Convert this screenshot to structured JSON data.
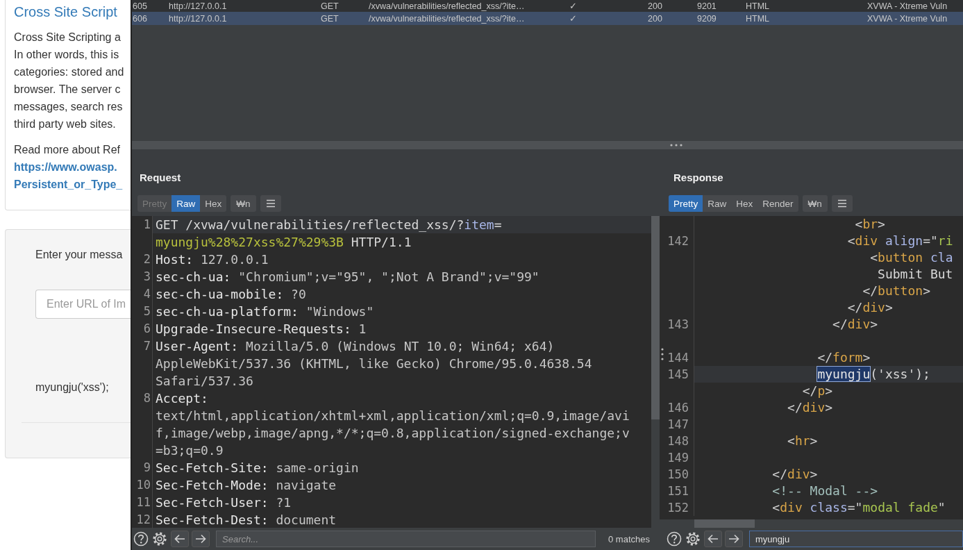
{
  "web_page": {
    "title": "Cross Site Script",
    "paragraph_lines": [
      "Cross Site Scripting a",
      "In other words, this is",
      "categories: stored and",
      "browser. The server c",
      "messages, search res",
      "third party web sites."
    ],
    "read_more": "Read more about Ref",
    "links": [
      "https://www.owasp.",
      "Persistent_or_Type_"
    ],
    "form": {
      "label": "Enter your messa",
      "input_placeholder": "Enter URL of Im",
      "output": "myungju('xss');"
    }
  },
  "history_table": {
    "rows": [
      {
        "selected": false,
        "cells": [
          "605",
          "http://127.0.0.1",
          "GET",
          "/xvwa/vulnerabilities/reflected_xss/?ite…",
          "✓",
          "200",
          "9201",
          "HTML",
          "XVWA - Xtreme Vuln"
        ]
      },
      {
        "selected": true,
        "cells": [
          "606",
          "http://127.0.0.1",
          "GET",
          "/xvwa/vulnerabilities/reflected_xss/?ite…",
          "✓",
          "200",
          "9209",
          "HTML",
          "XVWA - Xtreme Vuln"
        ]
      }
    ]
  },
  "panels": [
    {
      "title": "Request",
      "tabs": [
        {
          "label": "Pretty",
          "selected": false,
          "disabled": true
        },
        {
          "label": "Raw",
          "selected": true,
          "disabled": false
        },
        {
          "label": "Hex",
          "selected": false,
          "disabled": false
        }
      ],
      "newline_toggle": "₩n",
      "rows": [
        {
          "number": "1",
          "current": true,
          "tokens": [
            {
              "kind": "plain",
              "text": "GET /xvwa/vulnerabilities/reflected_xss/?"
            },
            {
              "kind": "param",
              "text": "item"
            },
            {
              "kind": "plain",
              "text": "="
            }
          ]
        },
        {
          "current": false,
          "tokens": [
            {
              "kind": "pvalue",
              "text": "myungju%28%27xss%27%29%3B"
            },
            {
              "kind": "plain",
              "text": " HTTP/1.1"
            }
          ]
        },
        {
          "number": "2",
          "current": false,
          "tokens": [
            {
              "kind": "name",
              "text": "Host:"
            },
            {
              "kind": "value",
              "text": " 127.0.0.1"
            }
          ]
        },
        {
          "number": "3",
          "current": false,
          "tokens": [
            {
              "kind": "name",
              "text": "sec-ch-ua:"
            },
            {
              "kind": "value",
              "text": " \"Chromium\";v=\"95\", \";Not A Brand\";v=\"99\""
            }
          ]
        },
        {
          "number": "4",
          "current": false,
          "tokens": [
            {
              "kind": "name",
              "text": "sec-ch-ua-mobile:"
            },
            {
              "kind": "value",
              "text": " ?0"
            }
          ]
        },
        {
          "number": "5",
          "current": false,
          "tokens": [
            {
              "kind": "name",
              "text": "sec-ch-ua-platform:"
            },
            {
              "kind": "value",
              "text": " \"Windows\""
            }
          ]
        },
        {
          "number": "6",
          "current": false,
          "tokens": [
            {
              "kind": "name",
              "text": "Upgrade-Insecure-Requests:"
            },
            {
              "kind": "value",
              "text": " 1"
            }
          ]
        },
        {
          "number": "7",
          "current": false,
          "tokens": [
            {
              "kind": "name",
              "text": "User-Agent:"
            },
            {
              "kind": "value",
              "text": " Mozilla/5.0 (Windows NT 10.0; Win64; x64)"
            }
          ]
        },
        {
          "current": false,
          "tokens": [
            {
              "kind": "value",
              "text": "AppleWebKit/537.36 (KHTML, like Gecko) Chrome/95.0.4638.54"
            }
          ]
        },
        {
          "current": false,
          "tokens": [
            {
              "kind": "value",
              "text": "Safari/537.36"
            }
          ]
        },
        {
          "number": "8",
          "current": false,
          "tokens": [
            {
              "kind": "name",
              "text": "Accept:"
            }
          ]
        },
        {
          "current": false,
          "tokens": [
            {
              "kind": "value",
              "text": "text/html,application/xhtml+xml,application/xml;q=0.9,image/avi"
            }
          ]
        },
        {
          "current": false,
          "tokens": [
            {
              "kind": "value",
              "text": "f,image/webp,image/apng,*/*;q=0.8,application/signed-exchange;v"
            }
          ]
        },
        {
          "current": false,
          "tokens": [
            {
              "kind": "value",
              "text": "=b3;q=0.9"
            }
          ]
        },
        {
          "number": "9",
          "current": false,
          "tokens": [
            {
              "kind": "name",
              "text": "Sec-Fetch-Site:"
            },
            {
              "kind": "value",
              "text": " same-origin"
            }
          ]
        },
        {
          "number": "10",
          "current": false,
          "tokens": [
            {
              "kind": "name",
              "text": "Sec-Fetch-Mode:"
            },
            {
              "kind": "value",
              "text": " navigate"
            }
          ]
        },
        {
          "number": "11",
          "current": false,
          "tokens": [
            {
              "kind": "name",
              "text": "Sec-Fetch-User:"
            },
            {
              "kind": "value",
              "text": " ?1"
            }
          ]
        },
        {
          "number": "12",
          "current": false,
          "tokens": [
            {
              "kind": "name",
              "text": "Sec-Fetch-Dest:"
            },
            {
              "kind": "value",
              "text": " document"
            }
          ]
        }
      ],
      "search": {
        "placeholder": "Search..."
      },
      "matches": "0 matches"
    },
    {
      "title": "Response",
      "tabs": [
        {
          "label": "Pretty",
          "selected": true,
          "disabled": false
        },
        {
          "label": "Raw",
          "selected": false,
          "disabled": false
        },
        {
          "label": "Hex",
          "selected": false,
          "disabled": false
        },
        {
          "label": "Render",
          "selected": false,
          "disabled": false
        }
      ],
      "newline_toggle": "₩n",
      "rows": [
        {
          "current": false,
          "tokens": [
            {
              "kind": "punct",
              "text": "                     <"
            },
            {
              "kind": "tag",
              "text": "br"
            },
            {
              "kind": "punct",
              "text": ">"
            }
          ]
        },
        {
          "number": "142",
          "current": false,
          "tokens": [
            {
              "kind": "punct",
              "text": "                    <"
            },
            {
              "kind": "tag",
              "text": "div"
            },
            {
              "kind": "attr",
              "text": " align"
            },
            {
              "kind": "punct",
              "text": "=\""
            },
            {
              "kind": "str",
              "text": "ri"
            }
          ]
        },
        {
          "current": false,
          "tokens": [
            {
              "kind": "punct",
              "text": "                       <"
            },
            {
              "kind": "tag",
              "text": "button"
            },
            {
              "kind": "attr",
              "text": " cla"
            }
          ]
        },
        {
          "current": false,
          "tokens": [
            {
              "kind": "text",
              "text": "                        Submit But"
            }
          ]
        },
        {
          "current": false,
          "tokens": [
            {
              "kind": "punct",
              "text": "                      </"
            },
            {
              "kind": "tag",
              "text": "button"
            },
            {
              "kind": "punct",
              "text": ">"
            }
          ]
        },
        {
          "current": false,
          "tokens": [
            {
              "kind": "punct",
              "text": "                    </"
            },
            {
              "kind": "tag",
              "text": "div"
            },
            {
              "kind": "punct",
              "text": ">"
            }
          ]
        },
        {
          "number": "143",
          "current": false,
          "tokens": [
            {
              "kind": "punct",
              "text": "                  </"
            },
            {
              "kind": "tag",
              "text": "div"
            },
            {
              "kind": "punct",
              "text": ">"
            }
          ]
        },
        {
          "current": false
        },
        {
          "number": "144",
          "current": false,
          "tokens": [
            {
              "kind": "punct",
              "text": "                </"
            },
            {
              "kind": "tag",
              "text": "form"
            },
            {
              "kind": "punct",
              "text": ">"
            }
          ]
        },
        {
          "number": "145",
          "current": true,
          "tokens": [
            {
              "kind": "match",
              "text": "                myungju"
            },
            {
              "kind": "text",
              "text": "('xss');"
            }
          ]
        },
        {
          "current": false,
          "tokens": [
            {
              "kind": "punct",
              "text": "              </"
            },
            {
              "kind": "tag",
              "text": "p"
            },
            {
              "kind": "punct",
              "text": ">"
            }
          ]
        },
        {
          "number": "146",
          "current": false,
          "tokens": [
            {
              "kind": "punct",
              "text": "            </"
            },
            {
              "kind": "tag",
              "text": "div"
            },
            {
              "kind": "punct",
              "text": ">"
            }
          ]
        },
        {
          "number": "147",
          "current": false
        },
        {
          "number": "148",
          "current": false,
          "tokens": [
            {
              "kind": "punct",
              "text": "            <"
            },
            {
              "kind": "tag",
              "text": "hr"
            },
            {
              "kind": "punct",
              "text": ">"
            }
          ]
        },
        {
          "number": "149",
          "current": false
        },
        {
          "number": "150",
          "current": false,
          "tokens": [
            {
              "kind": "punct",
              "text": "          </"
            },
            {
              "kind": "tag",
              "text": "div"
            },
            {
              "kind": "punct",
              "text": ">"
            }
          ]
        },
        {
          "number": "151",
          "current": false,
          "tokens": [
            {
              "kind": "comment",
              "text": "          <!-- Modal -->"
            }
          ]
        },
        {
          "number": "152",
          "current": false,
          "tokens": [
            {
              "kind": "punct",
              "text": "          <"
            },
            {
              "kind": "tag",
              "text": "div"
            },
            {
              "kind": "attr",
              "text": " class"
            },
            {
              "kind": "punct",
              "text": "=\""
            },
            {
              "kind": "str",
              "text": "modal fade"
            },
            {
              "kind": "punct",
              "text": "\""
            }
          ]
        }
      ],
      "search": {
        "value": "myungju"
      }
    }
  ]
}
